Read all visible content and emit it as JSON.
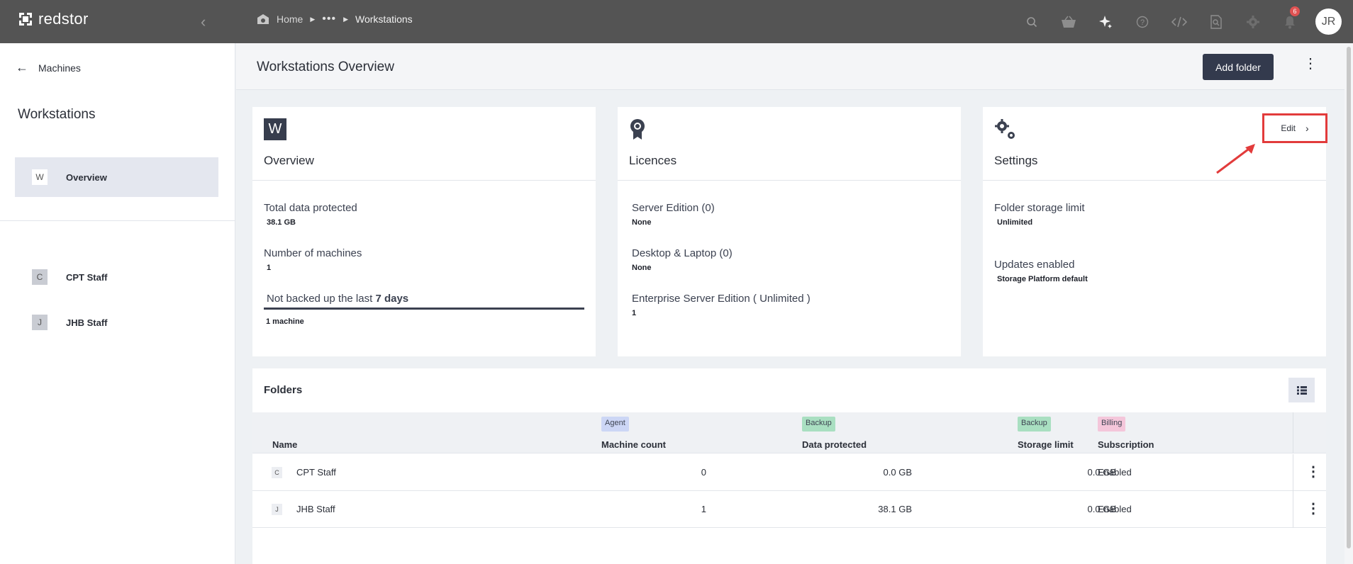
{
  "app": {
    "brand": "redstor"
  },
  "breadcrumb": {
    "home": "Home",
    "ellipsis": "•••",
    "current": "Workstations"
  },
  "topbar": {
    "icons": [
      "search-icon",
      "basket-icon",
      "sparkle-icon",
      "help-icon",
      "code-icon",
      "doc-search-icon",
      "gear-icon",
      "bell-icon"
    ],
    "notification_count": "6",
    "avatar_initials": "JR"
  },
  "sidebar": {
    "back_label": "Machines",
    "title": "Workstations",
    "items": [
      {
        "letter": "W",
        "label": "Overview"
      },
      {
        "letter": "C",
        "label": "CPT Staff"
      },
      {
        "letter": "J",
        "label": "JHB Staff"
      }
    ]
  },
  "header": {
    "title": "Workstations Overview",
    "add_folder_label": "Add folder"
  },
  "cards": {
    "overview": {
      "icon_letter": "W",
      "title": "Overview",
      "fields": [
        {
          "label": "Total data protected",
          "value": "38.1 GB"
        },
        {
          "label": "Number of machines",
          "value": "1"
        }
      ],
      "not_backed_prefix": "Not backed up the last",
      "not_backed_days": "7 days",
      "not_backed_value": "1 machine"
    },
    "licences": {
      "title": "Licences",
      "fields": [
        {
          "label": "Server Edition (0)",
          "value": "None"
        },
        {
          "label": "Desktop & Laptop (0)",
          "value": "None"
        },
        {
          "label": "Enterprise Server Edition ( Unlimited )",
          "value": "1"
        }
      ]
    },
    "settings": {
      "title": "Settings",
      "edit_label": "Edit",
      "fields": [
        {
          "label": "Folder storage limit",
          "value": "Unlimited"
        },
        {
          "label": "Updates enabled",
          "value": "Storage Platform default"
        }
      ]
    }
  },
  "folders": {
    "title": "Folders",
    "columns": [
      {
        "tag": "",
        "label": "Name"
      },
      {
        "tag": "Agent",
        "label": "Machine count"
      },
      {
        "tag": "Backup",
        "label": "Data protected"
      },
      {
        "tag": "Backup",
        "label": "Storage limit"
      },
      {
        "tag": "Billing",
        "label": "Subscription"
      }
    ],
    "rows": [
      {
        "letter": "C",
        "name": "CPT Staff",
        "machine_count": "0",
        "data_protected": "0.0 GB",
        "storage_limit": "0.0 GB",
        "subscription": "Enabled"
      },
      {
        "letter": "J",
        "name": "JHB Staff",
        "machine_count": "1",
        "data_protected": "38.1 GB",
        "storage_limit": "0.0 GB",
        "subscription": "Enabled"
      }
    ]
  },
  "colors": {
    "topbar": "#545454",
    "accent_dark": "#333a4d",
    "highlight_red": "#e23b3b"
  }
}
